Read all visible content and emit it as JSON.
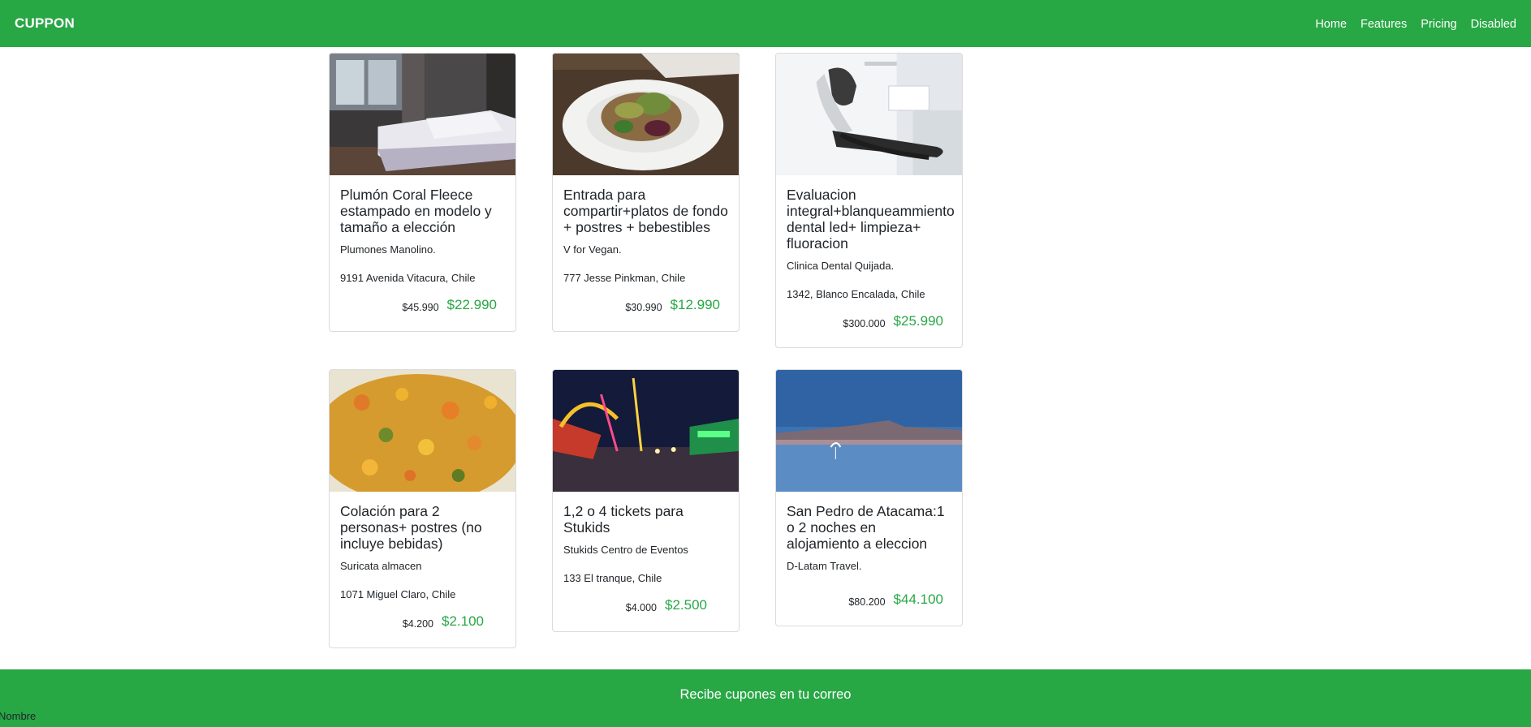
{
  "navbar": {
    "brand": "CUPPON",
    "links": [
      "Home",
      "Features",
      "Pricing",
      "Disabled"
    ]
  },
  "cards": [
    {
      "image": "bedroom-photo",
      "title": "Plumón Coral Fleece estampado en modelo y tamaño a elección",
      "merchant": "Plumones Manolino.",
      "address": "9191 Avenida Vitacura, Chile",
      "price_old": "$45.990",
      "price_new": "$22.990"
    },
    {
      "image": "vegan-salad-photo",
      "title": "Entrada para compartir+platos de fondo + postres + bebestibles",
      "merchant": "V for Vegan.",
      "address": "777 Jesse Pinkman, Chile",
      "price_old": "$30.990",
      "price_new": "$12.990"
    },
    {
      "image": "dental-chair-photo",
      "title": "Evaluacion integral+blanqueammiento dental led+ limpieza+ fluoracion",
      "merchant": "Clinica Dental Quijada.",
      "address": "1342, Blanco Encalada, Chile",
      "price_old": "$300.000",
      "price_new": "$25.990"
    },
    {
      "image": "food-dish-photo",
      "title": "Colación para 2 personas+ postres (no incluye bebidas)",
      "merchant": "Suricata almacen",
      "address": "1071 Miguel Claro, Chile",
      "price_old": "$4.200",
      "price_new": "$2.100"
    },
    {
      "image": "amusement-park-photo",
      "title": "1,2 o 4 tickets para Stukids",
      "merchant": "Stukids Centro de Eventos",
      "address": "133 El tranque, Chile",
      "price_old": "$4.000",
      "price_new": "$2.500"
    },
    {
      "image": "atacama-lagoon-photo",
      "title": "San Pedro de Atacama:1 o 2 noches en alojamiento a eleccion",
      "merchant": "D-Latam Travel.",
      "price_old": "$80.200",
      "price_new": "$44.100"
    }
  ],
  "footer": {
    "title": "Recibe cupones en tu correo",
    "name_label": "Nombre"
  },
  "colors": {
    "brand_green": "#28a745",
    "price_green": "#28a745"
  }
}
